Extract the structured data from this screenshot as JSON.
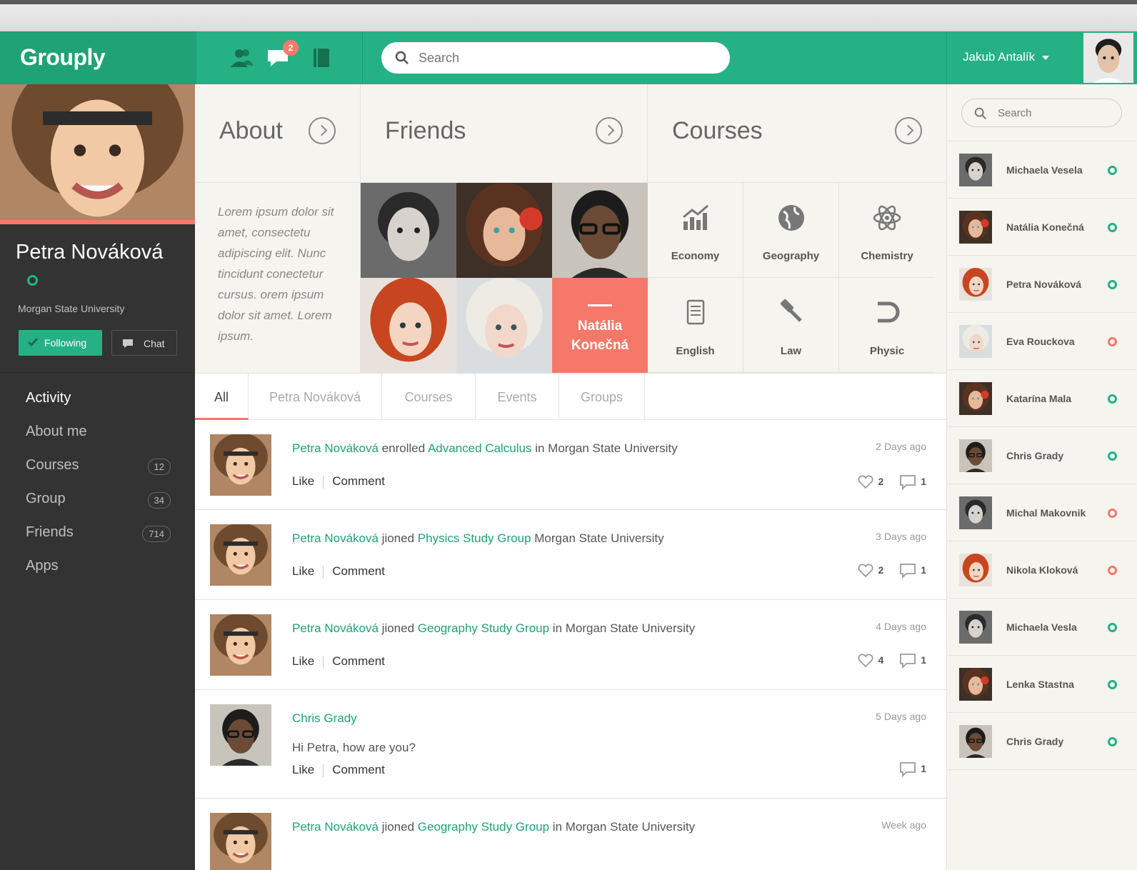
{
  "header": {
    "logo": "Grouply",
    "message_badge": "2",
    "search_placeholder": "Search",
    "user_name": "Jakub Antalík"
  },
  "profile": {
    "name": "Petra Nováková",
    "university": "Morgan State University",
    "follow_label": "Following",
    "chat_label": "Chat"
  },
  "nav": [
    {
      "label": "Activity",
      "count": null
    },
    {
      "label": "About me",
      "count": null
    },
    {
      "label": "Courses",
      "count": "12"
    },
    {
      "label": "Group",
      "count": "34"
    },
    {
      "label": "Friends",
      "count": "714"
    },
    {
      "label": "Apps",
      "count": null
    }
  ],
  "cards": {
    "about_title": "About",
    "friends_title": "Friends",
    "courses_title": "Courses",
    "about_text": "Lorem ipsum dolor sit amet, consectetu adipiscing elit. Nunc tincidunt conectetur cursus. orem ipsum dolor sit amet. Lorem ipsum.",
    "featured_friend": "Natália Konečná",
    "courses": [
      "Economy",
      "Geography",
      "Chemistry",
      "English",
      "Law",
      "Physic"
    ]
  },
  "tabs": [
    "All",
    "Petra Nováková",
    "Courses",
    "Events",
    "Groups"
  ],
  "feed": [
    {
      "actor": "Petra Nováková",
      "verb": " enrolled ",
      "object": "Advanced Calculus",
      "rest": " in Morgan State University",
      "time": "2 Days ago",
      "likes": "2",
      "comments": "1",
      "message": ""
    },
    {
      "actor": "Petra Nováková",
      "verb": " jioned ",
      "object": "Physics Study Group",
      "rest": " Morgan State University",
      "time": "3 Days ago",
      "likes": "2",
      "comments": "1",
      "message": ""
    },
    {
      "actor": "Petra Nováková",
      "verb": " jioned ",
      "object": "Geography Study Group",
      "rest": " in Morgan State University",
      "time": "4 Days ago",
      "likes": "4",
      "comments": "1",
      "message": ""
    },
    {
      "actor": "Chris Grady",
      "verb": "",
      "object": "",
      "rest": "",
      "time": "5 Days ago",
      "likes": "",
      "comments": "1",
      "message": "Hi Petra, how are you?"
    },
    {
      "actor": "Petra Nováková",
      "verb": " jioned ",
      "object": "Geography Study Group",
      "rest": " in Morgan State University",
      "time": "Week ago",
      "likes": "",
      "comments": "",
      "message": ""
    }
  ],
  "actions": {
    "like": "Like",
    "comment": "Comment"
  },
  "sidebar": {
    "search_placeholder": "Search",
    "contacts": [
      {
        "name": "Michaela Vesela",
        "status": "online"
      },
      {
        "name": "Natália Konečná",
        "status": "online"
      },
      {
        "name": "Petra Nováková",
        "status": "online"
      },
      {
        "name": "Eva Rouckova",
        "status": "away"
      },
      {
        "name": "Katarína Mala",
        "status": "online"
      },
      {
        "name": "Chris Grady",
        "status": "online"
      },
      {
        "name": "Michal Makovnik",
        "status": "away"
      },
      {
        "name": "Nikola Kloková",
        "status": "away"
      },
      {
        "name": "Michaela Vesla",
        "status": "online"
      },
      {
        "name": "Lenka Stastna",
        "status": "online"
      },
      {
        "name": "Chris Grady",
        "status": "online"
      }
    ]
  },
  "colors": {
    "brand": "#25b184",
    "accent": "#f6786a",
    "dark": "#333333"
  }
}
